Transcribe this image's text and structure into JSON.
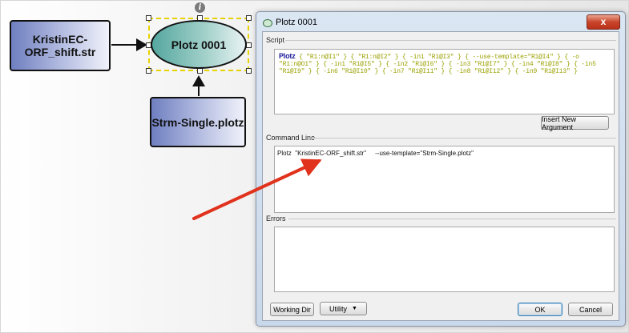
{
  "workflow": {
    "nodes": [
      {
        "label": "KristinEC-ORF_shift.str"
      },
      {
        "label": "Plotz 0001"
      },
      {
        "label": "Strm-Single.plotz"
      }
    ],
    "info_glyph": "i"
  },
  "dialog": {
    "title": "Plotz 0001",
    "close_glyph": "x",
    "script_label": "Script",
    "script_keyword": "Plotz",
    "script_args": "{ \"R1:n@I1\" } { \"R1:n@I2\" } { -in1 \"R1@I3\" } { --use-template=\"R1@I4\" } { -o \"R1:n@O1\" } { -in1 \"R1@I5\" } { -in2 \"R1@I6\" } { -in3 \"R1@I7\" } { -in4 \"R1@I8\" } { -in5 \"R1@I9\" } { -in6 \"R1@I10\" } { -in7 \"R1@I11\" } { -in8 \"R1@I12\" } { -in9 \"R1@I13\" }",
    "insert_button": "Insert New Argument",
    "command_label": "Command Line",
    "command_text": "Plotz  \"KristinEC-ORF_shift.str\"     --use-template=\"Strm-Single.plotz\"",
    "errors_label": "Errors",
    "errors_text": "",
    "working_dir_button": "Working Dir",
    "utility_button": "Utility",
    "ok_button": "OK",
    "cancel_button": "Cancel"
  },
  "colors": {
    "arrow": "#e0321c",
    "selection": "#e6d200",
    "script_keyword": "#1a1a9a",
    "script_args": "#9aa100"
  },
  "icons": [
    "info-icon",
    "plotz-window-icon",
    "close-icon",
    "dropdown-caret-icon"
  ]
}
